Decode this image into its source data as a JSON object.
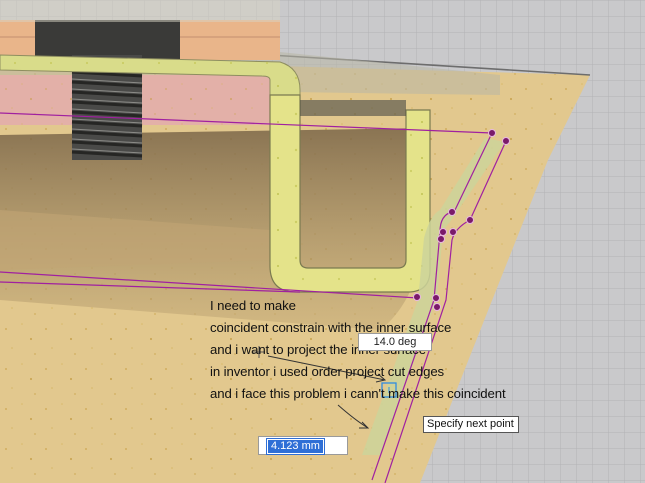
{
  "annotation": {
    "lines": [
      "I need to make",
      "coincident constrain with the inner surface",
      "and i want to project the inner surface",
      "in inventor i used order project cut edges",
      "and i face this problem i cann't make this coincident"
    ]
  },
  "dimensions": {
    "angle_value": "14.0 deg",
    "length_value": "4.123 mm"
  },
  "tooltip": {
    "text": "Specify next point"
  },
  "colors": {
    "background": "#c9c9cb",
    "grid": "#b3b3b6",
    "sketch_line": "#a020a0",
    "constraint_point": "#7a1a6a",
    "input_highlight": "#2f6fd6"
  }
}
